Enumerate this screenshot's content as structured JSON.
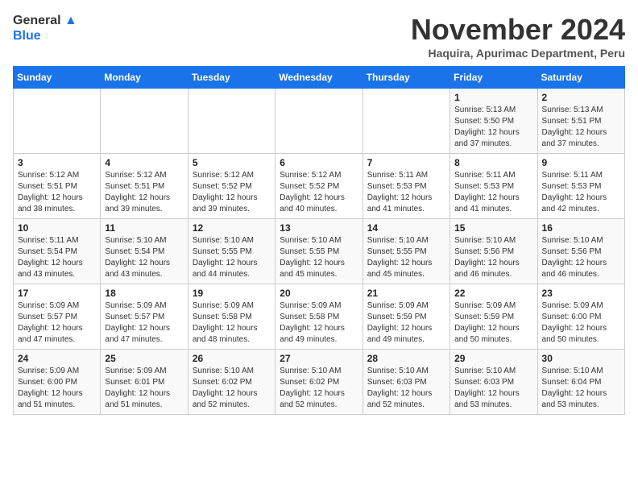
{
  "header": {
    "logo_line1": "General",
    "logo_line2": "Blue",
    "month": "November 2024",
    "location": "Haquira, Apurimac Department, Peru"
  },
  "days_of_week": [
    "Sunday",
    "Monday",
    "Tuesday",
    "Wednesday",
    "Thursday",
    "Friday",
    "Saturday"
  ],
  "weeks": [
    [
      {
        "day": "",
        "info": ""
      },
      {
        "day": "",
        "info": ""
      },
      {
        "day": "",
        "info": ""
      },
      {
        "day": "",
        "info": ""
      },
      {
        "day": "",
        "info": ""
      },
      {
        "day": "1",
        "info": "Sunrise: 5:13 AM\nSunset: 5:50 PM\nDaylight: 12 hours\nand 37 minutes."
      },
      {
        "day": "2",
        "info": "Sunrise: 5:13 AM\nSunset: 5:51 PM\nDaylight: 12 hours\nand 37 minutes."
      }
    ],
    [
      {
        "day": "3",
        "info": "Sunrise: 5:12 AM\nSunset: 5:51 PM\nDaylight: 12 hours\nand 38 minutes."
      },
      {
        "day": "4",
        "info": "Sunrise: 5:12 AM\nSunset: 5:51 PM\nDaylight: 12 hours\nand 39 minutes."
      },
      {
        "day": "5",
        "info": "Sunrise: 5:12 AM\nSunset: 5:52 PM\nDaylight: 12 hours\nand 39 minutes."
      },
      {
        "day": "6",
        "info": "Sunrise: 5:12 AM\nSunset: 5:52 PM\nDaylight: 12 hours\nand 40 minutes."
      },
      {
        "day": "7",
        "info": "Sunrise: 5:11 AM\nSunset: 5:53 PM\nDaylight: 12 hours\nand 41 minutes."
      },
      {
        "day": "8",
        "info": "Sunrise: 5:11 AM\nSunset: 5:53 PM\nDaylight: 12 hours\nand 41 minutes."
      },
      {
        "day": "9",
        "info": "Sunrise: 5:11 AM\nSunset: 5:53 PM\nDaylight: 12 hours\nand 42 minutes."
      }
    ],
    [
      {
        "day": "10",
        "info": "Sunrise: 5:11 AM\nSunset: 5:54 PM\nDaylight: 12 hours\nand 43 minutes."
      },
      {
        "day": "11",
        "info": "Sunrise: 5:10 AM\nSunset: 5:54 PM\nDaylight: 12 hours\nand 43 minutes."
      },
      {
        "day": "12",
        "info": "Sunrise: 5:10 AM\nSunset: 5:55 PM\nDaylight: 12 hours\nand 44 minutes."
      },
      {
        "day": "13",
        "info": "Sunrise: 5:10 AM\nSunset: 5:55 PM\nDaylight: 12 hours\nand 45 minutes."
      },
      {
        "day": "14",
        "info": "Sunrise: 5:10 AM\nSunset: 5:55 PM\nDaylight: 12 hours\nand 45 minutes."
      },
      {
        "day": "15",
        "info": "Sunrise: 5:10 AM\nSunset: 5:56 PM\nDaylight: 12 hours\nand 46 minutes."
      },
      {
        "day": "16",
        "info": "Sunrise: 5:10 AM\nSunset: 5:56 PM\nDaylight: 12 hours\nand 46 minutes."
      }
    ],
    [
      {
        "day": "17",
        "info": "Sunrise: 5:09 AM\nSunset: 5:57 PM\nDaylight: 12 hours\nand 47 minutes."
      },
      {
        "day": "18",
        "info": "Sunrise: 5:09 AM\nSunset: 5:57 PM\nDaylight: 12 hours\nand 47 minutes."
      },
      {
        "day": "19",
        "info": "Sunrise: 5:09 AM\nSunset: 5:58 PM\nDaylight: 12 hours\nand 48 minutes."
      },
      {
        "day": "20",
        "info": "Sunrise: 5:09 AM\nSunset: 5:58 PM\nDaylight: 12 hours\nand 49 minutes."
      },
      {
        "day": "21",
        "info": "Sunrise: 5:09 AM\nSunset: 5:59 PM\nDaylight: 12 hours\nand 49 minutes."
      },
      {
        "day": "22",
        "info": "Sunrise: 5:09 AM\nSunset: 5:59 PM\nDaylight: 12 hours\nand 50 minutes."
      },
      {
        "day": "23",
        "info": "Sunrise: 5:09 AM\nSunset: 6:00 PM\nDaylight: 12 hours\nand 50 minutes."
      }
    ],
    [
      {
        "day": "24",
        "info": "Sunrise: 5:09 AM\nSunset: 6:00 PM\nDaylight: 12 hours\nand 51 minutes."
      },
      {
        "day": "25",
        "info": "Sunrise: 5:09 AM\nSunset: 6:01 PM\nDaylight: 12 hours\nand 51 minutes."
      },
      {
        "day": "26",
        "info": "Sunrise: 5:10 AM\nSunset: 6:02 PM\nDaylight: 12 hours\nand 52 minutes."
      },
      {
        "day": "27",
        "info": "Sunrise: 5:10 AM\nSunset: 6:02 PM\nDaylight: 12 hours\nand 52 minutes."
      },
      {
        "day": "28",
        "info": "Sunrise: 5:10 AM\nSunset: 6:03 PM\nDaylight: 12 hours\nand 52 minutes."
      },
      {
        "day": "29",
        "info": "Sunrise: 5:10 AM\nSunset: 6:03 PM\nDaylight: 12 hours\nand 53 minutes."
      },
      {
        "day": "30",
        "info": "Sunrise: 5:10 AM\nSunset: 6:04 PM\nDaylight: 12 hours\nand 53 minutes."
      }
    ]
  ]
}
